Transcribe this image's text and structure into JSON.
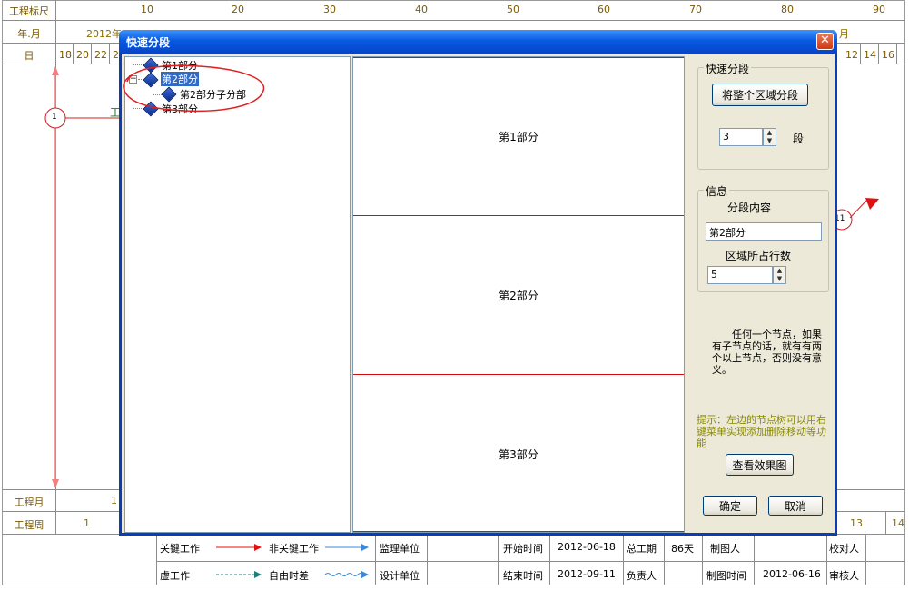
{
  "sheet": {
    "row_labels": {
      "scale": "工程标尺",
      "year_month": "年.月",
      "day": "日",
      "month": "工程月",
      "week": "工程周"
    },
    "scale_ticks": [
      "10",
      "20",
      "30",
      "40",
      "50",
      "60",
      "70",
      "80",
      "90"
    ],
    "year_month_start": "2012年",
    "year_month_end": "月",
    "days_left": [
      "18",
      "20",
      "22",
      "2"
    ],
    "days_right": [
      "12",
      "14",
      "16"
    ],
    "month_value": "1",
    "week_values": [
      "1",
      "13",
      "14"
    ],
    "node_1": "1",
    "node_11": "11",
    "fragment_text": "工"
  },
  "legend": {
    "critical_work": "关键工作",
    "non_critical_work": "非关键工作",
    "virtual_work": "虚工作",
    "free_float": "自由时差",
    "supervision_unit": "监理单位",
    "design_unit": "设计单位",
    "start_time_label": "开始时间",
    "start_time": "2012-06-18",
    "end_time_label": "结束时间",
    "end_time": "2012-09-11",
    "total_duration_label": "总工期",
    "total_duration": "86天",
    "responsible_label": "负责人",
    "drafter_label": "制图人",
    "draw_time_label": "制图时间",
    "draw_time": "2012-06-16",
    "checker_label": "校对人",
    "reviewer_label": "审核人"
  },
  "dialog": {
    "title": "快速分段",
    "close": "✕",
    "tree": {
      "items": [
        {
          "label": "第1部分"
        },
        {
          "label": "第2部分",
          "selected": true
        },
        {
          "label": "第2部分子分部"
        },
        {
          "label": "第3部分"
        }
      ]
    },
    "preview": {
      "segments": [
        "第1部分",
        "第2部分",
        "第3部分"
      ]
    },
    "quick_segment": {
      "group_title": "快速分段",
      "button": "将整个区域分段",
      "count": "3",
      "unit": "段"
    },
    "info": {
      "group_title": "信息",
      "content_label": "分段内容",
      "content_value": "第2部分",
      "rows_label": "区域所占行数",
      "rows_value": "5"
    },
    "note": "任何一个节点，如果有子节点的话，就有有两个以上节点，否则没有意义。",
    "hint": "提示：左边的节点树可以用右键菜单实现添加删除移动等功能",
    "view_button": "查看效果图",
    "ok_button": "确定",
    "cancel_button": "取消"
  },
  "colors": {
    "title_bar": "#0a5ae0",
    "dialog_bg": "#ece9d8",
    "segment_line": "#d01010",
    "hint_text": "#8a8a00",
    "highlight_circle": "#e02020"
  }
}
